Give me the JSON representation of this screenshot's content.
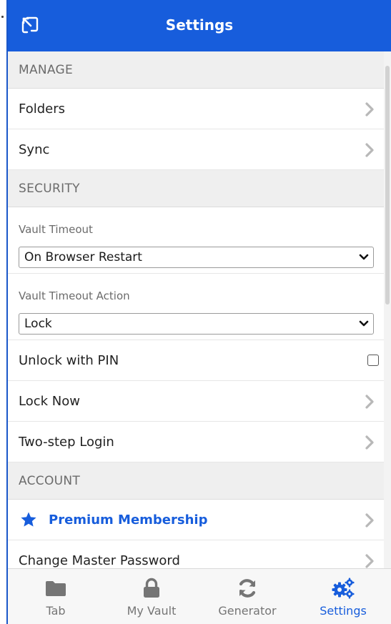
{
  "header": {
    "title": "Settings",
    "popout_icon": "popout-icon"
  },
  "sections": {
    "manage": {
      "title": "MANAGE",
      "folders": "Folders",
      "sync": "Sync"
    },
    "security": {
      "title": "SECURITY",
      "vault_timeout_label": "Vault Timeout",
      "vault_timeout_value": "On Browser Restart",
      "vault_timeout_action_label": "Vault Timeout Action",
      "vault_timeout_action_value": "Lock",
      "unlock_pin": "Unlock with PIN",
      "unlock_pin_checked": false,
      "lock_now": "Lock Now",
      "two_step": "Two-step Login"
    },
    "account": {
      "title": "ACCOUNT",
      "premium": "Premium Membership",
      "change_password": "Change Master Password"
    }
  },
  "tabs": [
    {
      "label": "Tab",
      "icon": "folder-icon",
      "active": false
    },
    {
      "label": "My Vault",
      "icon": "lock-icon",
      "active": false
    },
    {
      "label": "Generator",
      "icon": "refresh-icon",
      "active": false
    },
    {
      "label": "Settings",
      "icon": "cogs-icon",
      "active": true
    }
  ],
  "colors": {
    "brand": "#175ddc",
    "section_bg": "#efefef",
    "chevron": "#b8b8b8",
    "tab_inactive": "#757575"
  }
}
